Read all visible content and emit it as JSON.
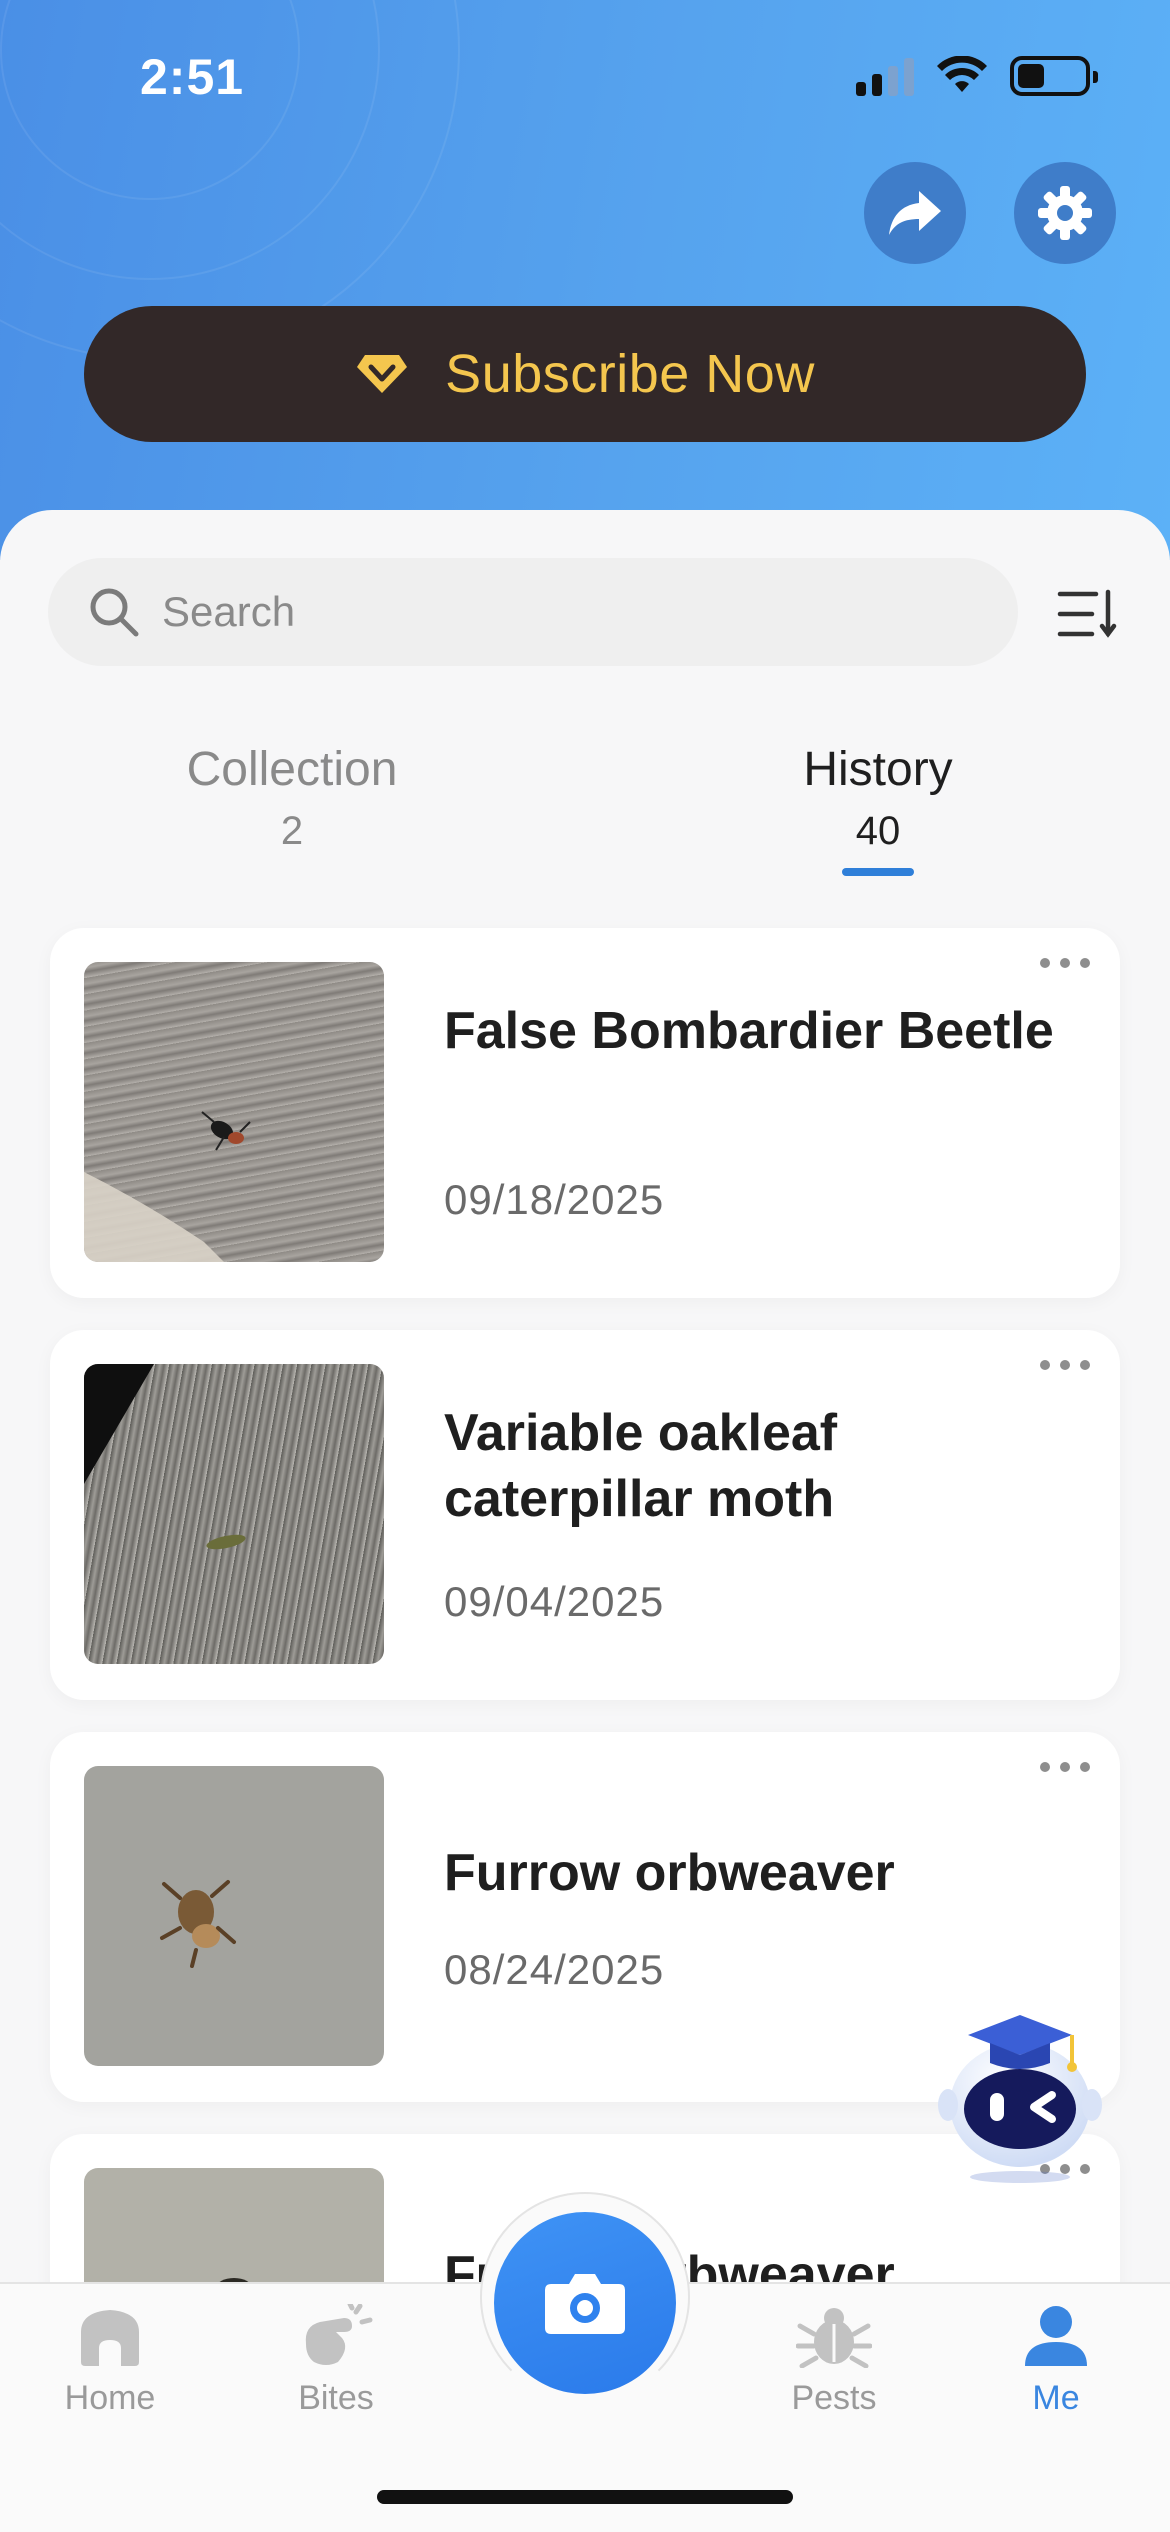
{
  "status_bar": {
    "time": "2:51",
    "icons": [
      "cellular-signal-icon",
      "wifi-icon",
      "battery-icon"
    ]
  },
  "header": {
    "share_icon": "share-arrow-icon",
    "settings_icon": "gear-icon",
    "subscribe_label": "Subscribe Now",
    "subscribe_icon": "diamond-icon",
    "colors": {
      "gradient_start": "#4a8fe6",
      "gradient_end": "#5cb1f7",
      "subscribe_bg": "#322828",
      "subscribe_text": "#f4c64e"
    }
  },
  "search": {
    "placeholder": "Search",
    "value": ""
  },
  "sort_icon": "sort-list-icon",
  "tabs": [
    {
      "label": "Collection",
      "count": "2",
      "active": false
    },
    {
      "label": "History",
      "count": "40",
      "active": true
    }
  ],
  "history": [
    {
      "title": "False Bombardier Beetle",
      "date": "09/18/2025"
    },
    {
      "title": "Variable oakleaf caterpillar moth",
      "date": "09/04/2025"
    },
    {
      "title": "Furrow orbweaver",
      "date": "08/24/2025"
    },
    {
      "title": "Furrow orbweaver",
      "date": ""
    }
  ],
  "bottom_nav": [
    {
      "label": "Home",
      "icon": "home-icon",
      "active": false
    },
    {
      "label": "Bites",
      "icon": "bite-hand-icon",
      "active": false
    },
    {
      "label": "",
      "icon": "camera-icon",
      "active": false
    },
    {
      "label": "Pests",
      "icon": "bug-icon",
      "active": false
    },
    {
      "label": "Me",
      "icon": "person-icon",
      "active": true
    }
  ],
  "assistant_icon": "robot-assistant-icon",
  "accent_color": "#3a86e0"
}
